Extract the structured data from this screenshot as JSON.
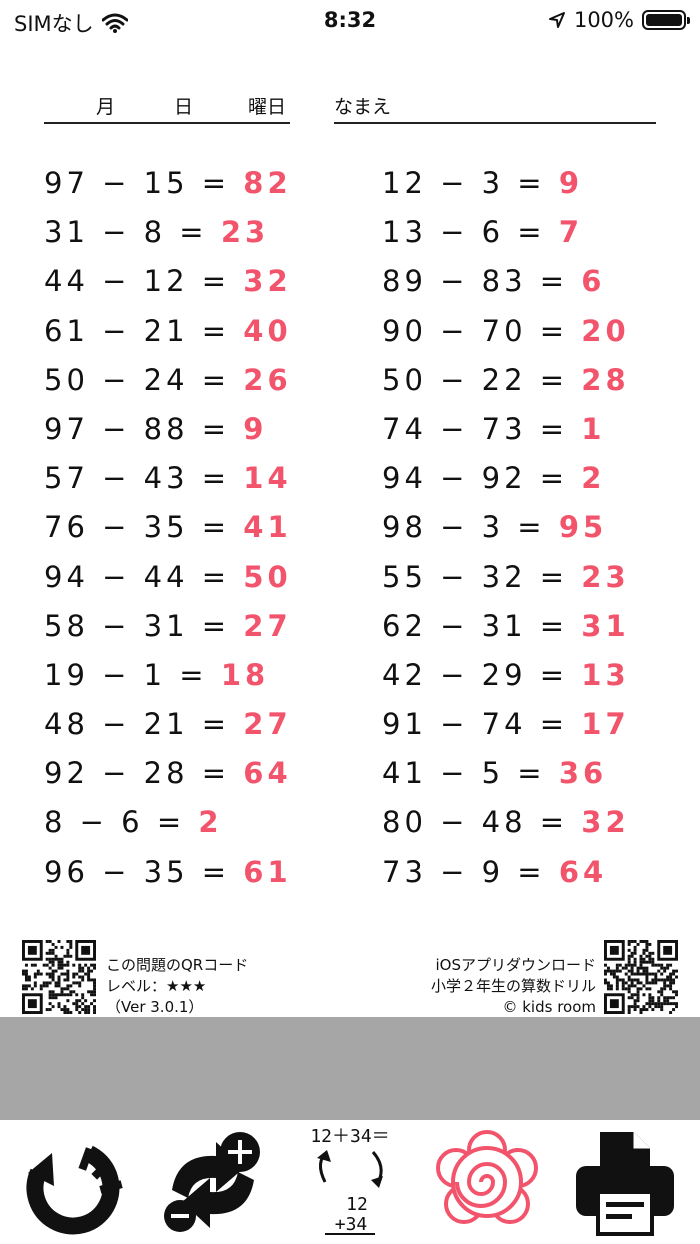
{
  "status_bar": {
    "carrier": "SIMなし",
    "time": "8:32",
    "battery": "100%"
  },
  "header": {
    "month": "月",
    "day": "日",
    "weekday": "曜日",
    "name": "なまえ"
  },
  "problems_left": [
    {
      "q": "97 − 15 =",
      "a": "82"
    },
    {
      "q": "31 − 8 =",
      "a": "23"
    },
    {
      "q": "44 − 12 =",
      "a": "32"
    },
    {
      "q": "61 − 21 =",
      "a": "40"
    },
    {
      "q": "50 − 24 =",
      "a": "26"
    },
    {
      "q": "97 − 88 =",
      "a": "9"
    },
    {
      "q": "57 − 43 =",
      "a": "14"
    },
    {
      "q": "76 − 35 =",
      "a": "41"
    },
    {
      "q": "94 − 44 =",
      "a": "50"
    },
    {
      "q": "58 − 31 =",
      "a": "27"
    },
    {
      "q": "19 − 1 =",
      "a": "18"
    },
    {
      "q": "48 − 21 =",
      "a": "27"
    },
    {
      "q": "92 − 28 =",
      "a": "64"
    },
    {
      "q": "8 − 6 =",
      "a": "2"
    },
    {
      "q": "96 − 35 =",
      "a": "61"
    }
  ],
  "problems_right": [
    {
      "q": "12 − 3 =",
      "a": "9"
    },
    {
      "q": "13 − 6 =",
      "a": "7"
    },
    {
      "q": "89 − 83 =",
      "a": "6"
    },
    {
      "q": "90 − 70 =",
      "a": "20"
    },
    {
      "q": "50 − 22 =",
      "a": "28"
    },
    {
      "q": "74 − 73 =",
      "a": "1"
    },
    {
      "q": "94 − 92 =",
      "a": "2"
    },
    {
      "q": "98 − 3 =",
      "a": "95"
    },
    {
      "q": "55 − 32 =",
      "a": "23"
    },
    {
      "q": "62 − 31 =",
      "a": "31"
    },
    {
      "q": "42 − 29 =",
      "a": "13"
    },
    {
      "q": "91 − 74 =",
      "a": "17"
    },
    {
      "q": "41 − 5 =",
      "a": "36"
    },
    {
      "q": "80 − 48 =",
      "a": "32"
    },
    {
      "q": "73 − 9 =",
      "a": "64"
    }
  ],
  "footer": {
    "qr_label": "この問題のQRコード",
    "level": "レベル：★★★",
    "version": "（Ver 3.0.1）",
    "download": "iOSアプリダウンロード",
    "app_name": "小学２年生の算数ドリル",
    "copyright": "© kids room"
  },
  "toolbar": {
    "swap_top": "12＋34＝",
    "swap_bottom_1": "12",
    "swap_bottom_2": "+34",
    "icons": [
      "reset-icon",
      "new-problems-icon",
      "format-swap-icon",
      "hanamaru-icon",
      "print-icon"
    ]
  },
  "colors": {
    "answer": "#f2546c",
    "gray_area": "#a6a6a6"
  }
}
